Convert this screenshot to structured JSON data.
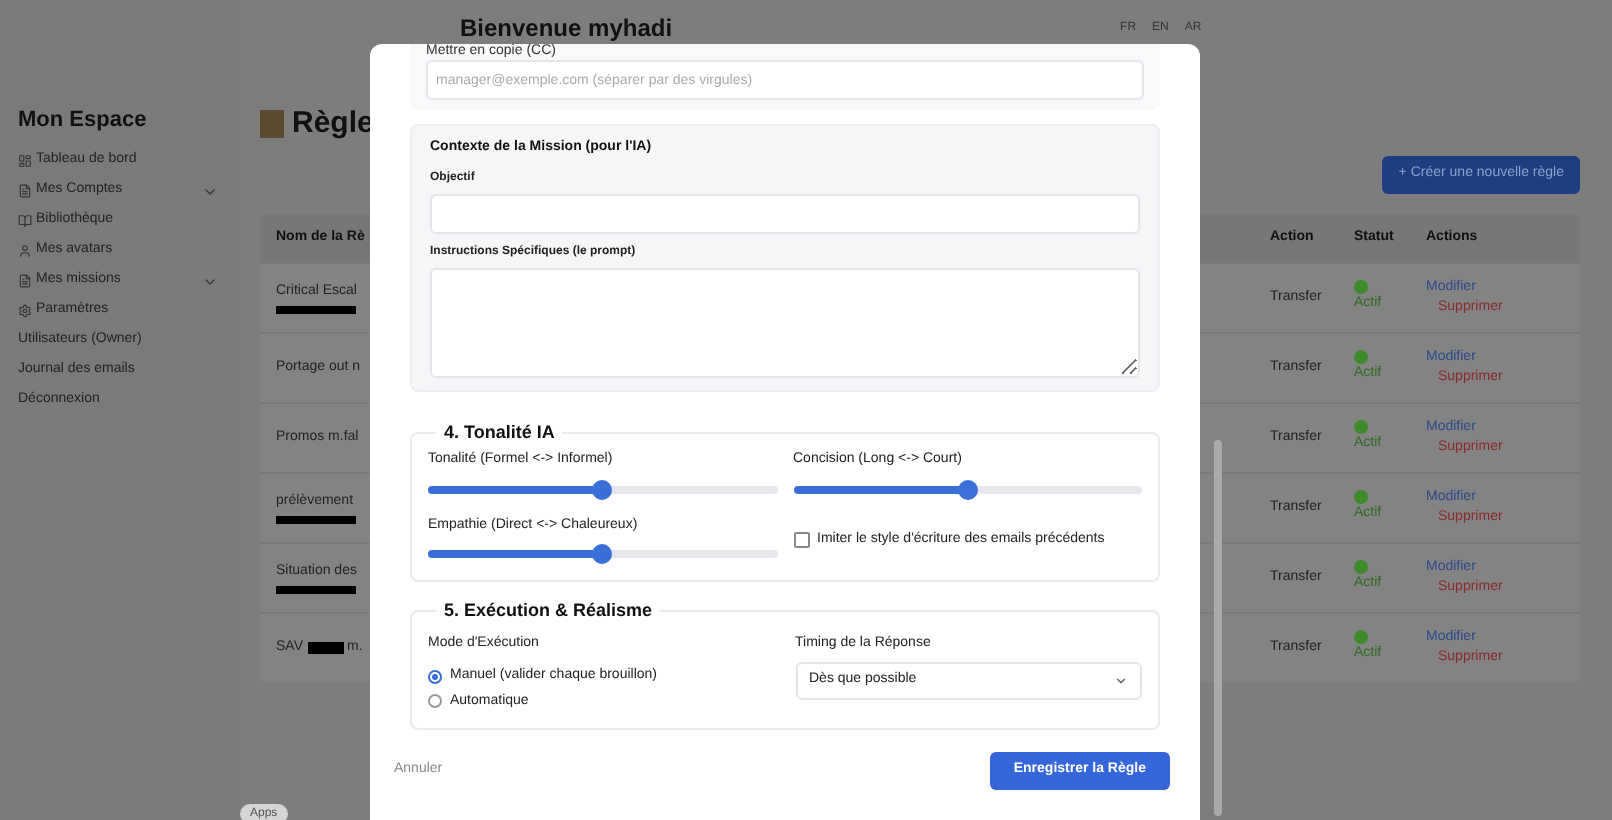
{
  "header": {
    "greeting": "Bienvenue myhadi",
    "languages": [
      "FR",
      "EN",
      "AR"
    ]
  },
  "sidebar": {
    "title": "Mon Espace",
    "items": [
      {
        "label": "Tableau de bord",
        "kind": "icon",
        "expandable": false
      },
      {
        "label": "Mes Comptes",
        "kind": "icon",
        "expandable": true
      },
      {
        "label": "Bibliothèque",
        "kind": "icon",
        "expandable": false
      },
      {
        "label": "Mes avatars",
        "kind": "icon",
        "expandable": false
      },
      {
        "label": "Mes missions",
        "kind": "icon",
        "expandable": true
      },
      {
        "label": "Paramètres",
        "kind": "icon",
        "expandable": false
      },
      {
        "label": "Utilisateurs (Owner)",
        "kind": "plain",
        "expandable": false
      },
      {
        "label": "Journal des emails",
        "kind": "plain",
        "expandable": false
      },
      {
        "label": "Déconnexion",
        "kind": "plain",
        "expandable": false
      }
    ]
  },
  "page": {
    "title": "Règle",
    "create_button": "+ Créer une nouvelle règle"
  },
  "table": {
    "columns": [
      "Nom de la Rè",
      "Action",
      "Statut",
      "Actions"
    ],
    "rows": [
      {
        "name": "Critical Escal",
        "kind": "redacted",
        "action": "Transfer",
        "status": "Actif",
        "edit": "Modifier",
        "delete": "Supprimer"
      },
      {
        "name": "Portage out n",
        "kind": "plain",
        "action": "Transfer",
        "status": "Actif",
        "edit": "Modifier",
        "delete": "Supprimer"
      },
      {
        "name": "Promos m.fal",
        "kind": "plain",
        "action": "Transfer",
        "status": "Actif",
        "edit": "Modifier",
        "delete": "Supprimer"
      },
      {
        "name": "prélèvement",
        "kind": "redacted",
        "action": "Transfer",
        "status": "Actif",
        "edit": "Modifier",
        "delete": "Supprimer"
      },
      {
        "name": "Situation des",
        "kind": "redacted",
        "action": "Transfer",
        "status": "Actif",
        "edit": "Modifier",
        "delete": "Supprimer"
      },
      {
        "name": "SAV",
        "suffix": "m.",
        "kind": "inline",
        "action": "Transfer",
        "status": "Actif",
        "edit": "Modifier",
        "delete": "Supprimer"
      }
    ]
  },
  "apps_button": "Apps",
  "modal": {
    "cc": {
      "label": "Mettre en copie (CC)",
      "placeholder": "manager@exemple.com (séparer par des virgules)"
    },
    "context": {
      "title": "Contexte de la Mission (pour l'IA)",
      "objective_label": "Objectif",
      "instructions_label": "Instructions Spécifiques (le prompt)"
    },
    "tone": {
      "title": "4. Tonalité IA",
      "sliders": [
        {
          "label": "Tonalité (Formel <-> Informel)",
          "level": 0.5
        },
        {
          "label": "Concision (Long <-> Court)",
          "level": 0.5
        },
        {
          "label": "Empathie (Direct <-> Chaleureux)",
          "level": 0.5
        }
      ],
      "imitate": {
        "label": "Imiter le style d'écriture des emails précédents",
        "checked": false
      }
    },
    "execution": {
      "title": "5. Exécution & Réalisme",
      "mode_label": "Mode d'Exécution",
      "modes": [
        {
          "label": "Manuel (valider chaque brouillon)",
          "selected": true
        },
        {
          "label": "Automatique",
          "selected": false
        }
      ],
      "timing_label": "Timing de la Réponse",
      "timing_value": "Dès que possible"
    },
    "cancel": "Annuler",
    "save": "Enregistrer la Règle"
  }
}
